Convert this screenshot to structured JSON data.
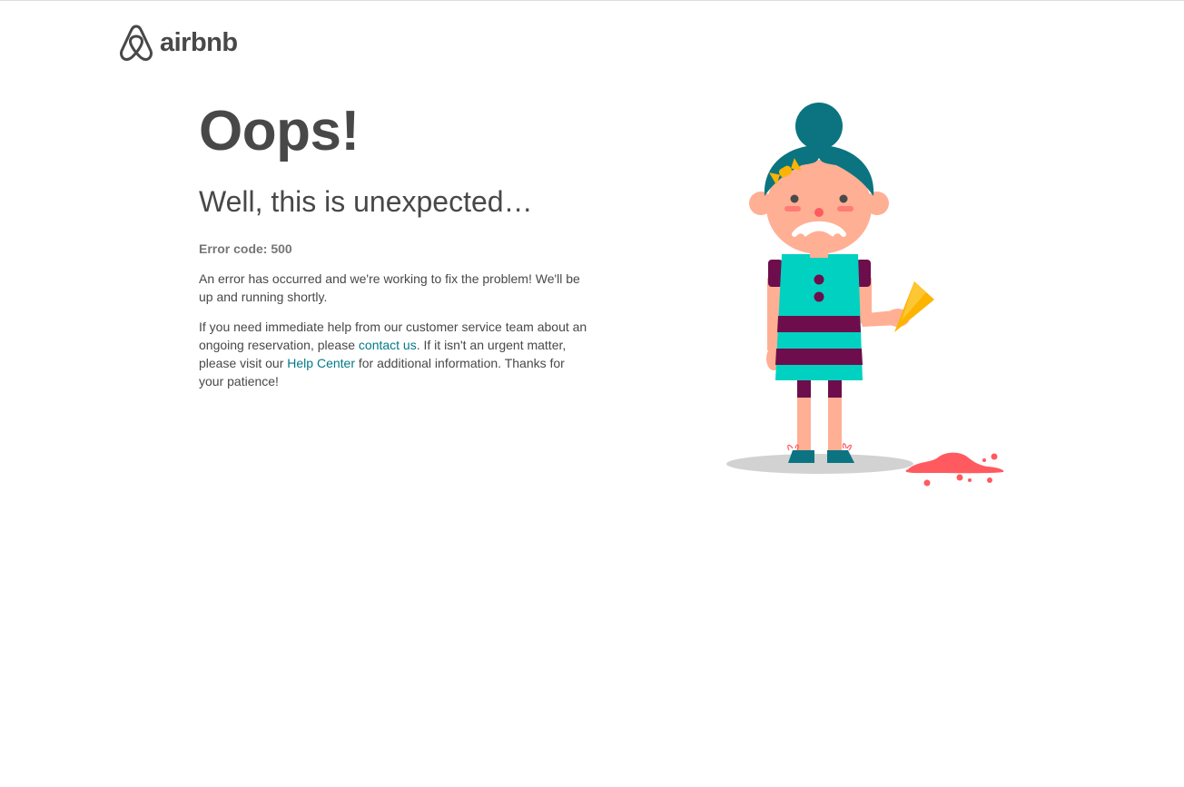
{
  "header": {
    "logo_text": "airbnb",
    "brand_color": "#484848"
  },
  "error": {
    "title": "Oops!",
    "subtitle": "Well, this is unexpected…",
    "code_line": "Error code: 500",
    "message": "An error has occurred and we're working to fix the problem! We'll be up and running shortly.",
    "help_prefix": "If you need immediate help from our customer service team about an ongoing reservation, please ",
    "contact_link": "contact us",
    "help_middle": ". If it isn't an urgent matter, please visit our ",
    "help_center_link": "Help Center",
    "help_suffix": " for additional information. Thanks for your patience!"
  },
  "colors": {
    "link": "#007a87",
    "text": "#484848",
    "muted": "#767676"
  },
  "illustration": {
    "icon": "sad-girl-dropped-ice-cream-illustration"
  }
}
